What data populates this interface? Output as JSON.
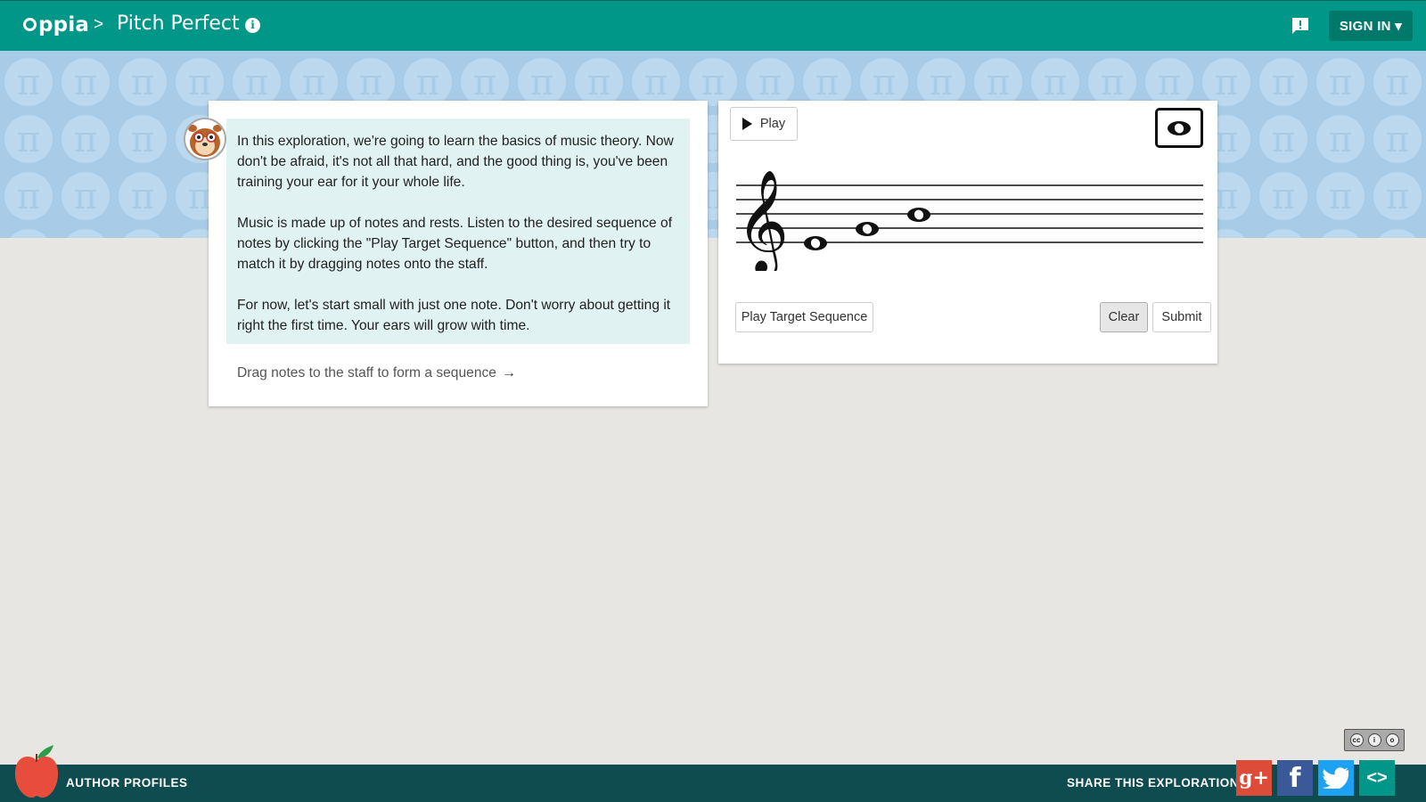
{
  "header": {
    "logo_text": "ppia",
    "breadcrumb_separator": ">",
    "exploration_title": "Pitch Perfect",
    "info_icon": "info-icon",
    "feedback_icon": "feedback-icon",
    "signin_label": "SIGN IN ▾"
  },
  "tutor": {
    "avatar_icon": "oppia-avatar-icon",
    "paragraphs": [
      "In this exploration, we're going to learn the basics of music theory. Now don't be afraid, it's not all that hard, and the good thing is, you've been training your ear for it your whole life.",
      "Music is made up of notes and rests. Listen to the desired sequence of notes by clicking the \"Play Target Sequence\" button, and then try to match it by dragging notes onto the staff.",
      "For now, let's start small with just one note. Don't worry about getting it right the first time. Your ears will grow with time."
    ],
    "hint_text": "Drag notes to the staff to form a sequence",
    "hint_arrow": "→"
  },
  "interaction": {
    "play_label": "Play",
    "play_target_label": "Play Target Sequence",
    "clear_label": "Clear",
    "submit_label": "Submit",
    "note_selector_icon": "whole-note-icon",
    "clef_icon": "treble-clef-icon",
    "staff_notes": [
      "E4",
      "G4",
      "B4"
    ]
  },
  "footer": {
    "author_profiles_label": "AUTHOR PROFILES",
    "share_label": "SHARE THIS EXPLORATION",
    "gplus_label": "g+",
    "facebook_label": "f",
    "twitter_icon": "twitter-bird-icon",
    "embed_label": "<>",
    "license_badge": "cc-by-sa-icon"
  },
  "colors": {
    "header": "#009688",
    "banner": "#a8cbe8",
    "content_box": "#e0f2f1",
    "footer": "#0f4c4f"
  }
}
